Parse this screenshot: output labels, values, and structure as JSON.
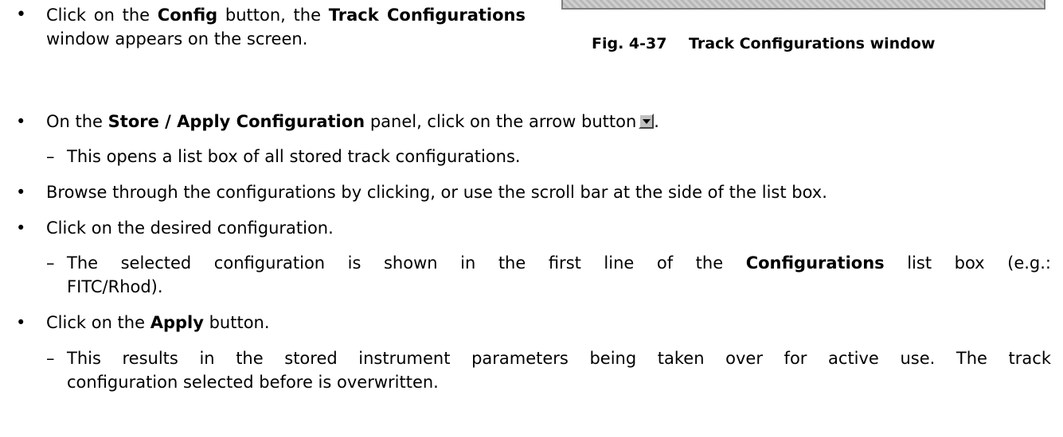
{
  "figure": {
    "number": "Fig. 4-37",
    "title": "Track Configurations window"
  },
  "steps": [
    {
      "pre": "Click on the ",
      "b1": "Config",
      "mid": " button, the ",
      "b2": "Track Configurations",
      "post": " window appears on the screen."
    },
    {
      "pre": "On the ",
      "b1": "Store / Apply Configuration",
      "post": " panel, click on the arrow button",
      "icon": "dropdown-arrow-icon"
    },
    {
      "text": "This opens a list box of all stored track configurations."
    },
    {
      "text": "Browse through the configurations by clicking, or use the scroll bar at the side of the list box."
    },
    {
      "text": "Click on the desired configuration."
    },
    {
      "pre": "The selected configuration is shown in the first line of the ",
      "b1": "Configurations",
      "post": " list box (e.g.:",
      "cont": "FITC/Rhod)."
    },
    {
      "pre": "Click on the ",
      "b1": "Apply",
      "post": " button."
    },
    {
      "line1": "This results in the stored instrument parameters being taken over for active use. The track",
      "line2": "configuration selected before is overwritten."
    }
  ]
}
